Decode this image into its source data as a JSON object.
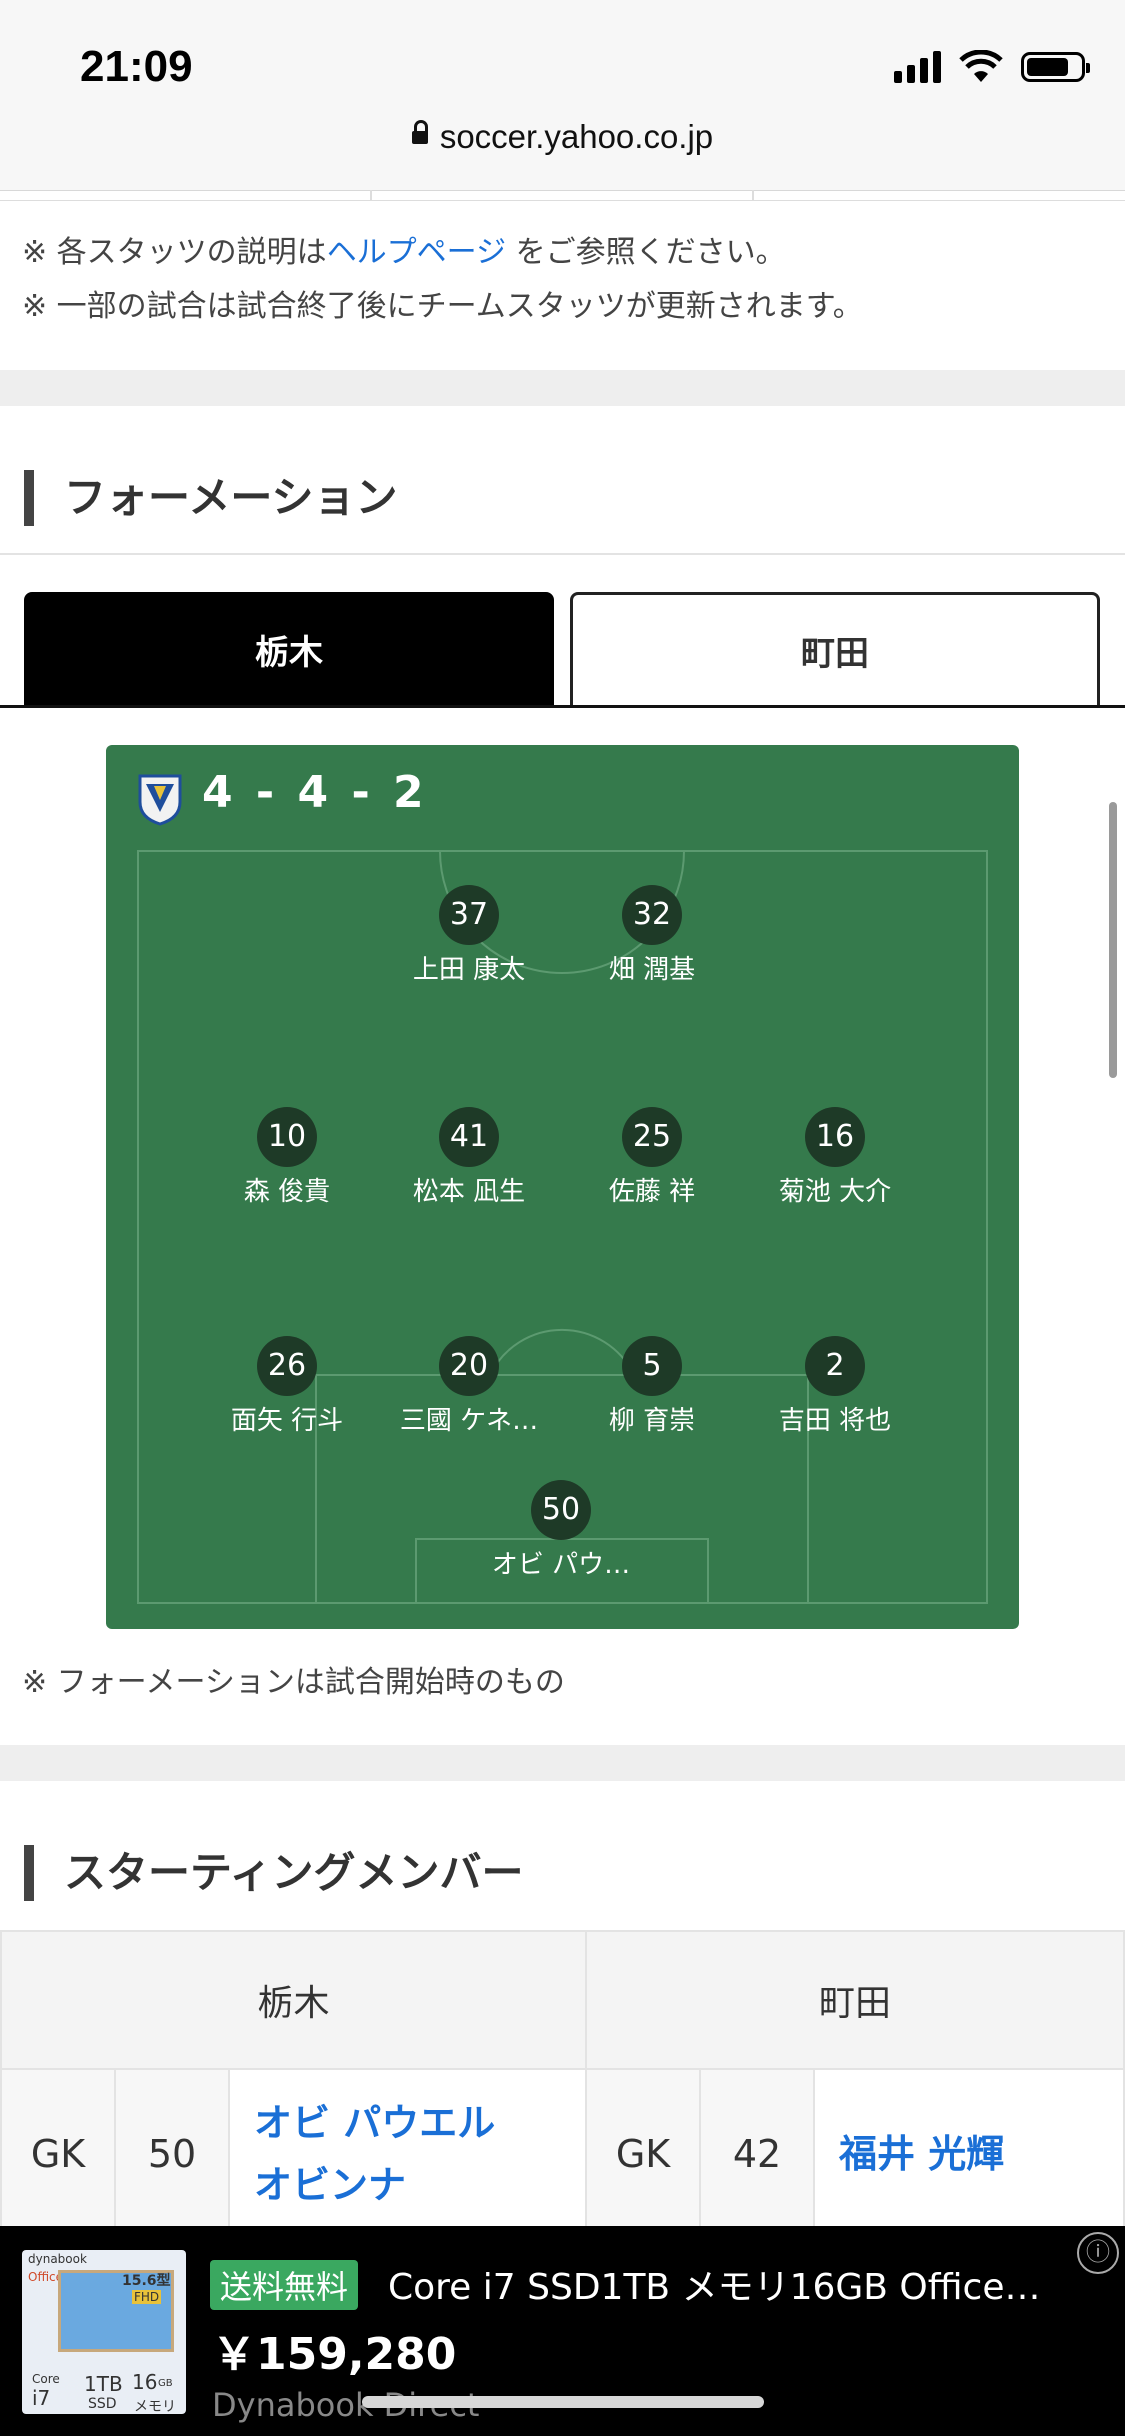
{
  "status_bar": {
    "time": "21:09",
    "url": "soccer.yahoo.co.jp"
  },
  "notes": {
    "line1_prefix": "※ 各スタッツの説明は",
    "line1_link": "ヘルプページ",
    "line1_suffix": "をご参照ください。",
    "line2": "※ 一部の試合は試合終了後にチームスタッツが更新されます。"
  },
  "formation_section": {
    "title": "フォーメーション",
    "tabs": [
      {
        "label": "栃木",
        "active": true
      },
      {
        "label": "町田",
        "active": false
      }
    ],
    "formation": "4 - 4 - 2",
    "players": [
      {
        "number": "37",
        "name": "上田 康太"
      },
      {
        "number": "32",
        "name": "畑 潤基"
      },
      {
        "number": "10",
        "name": "森 俊貴"
      },
      {
        "number": "41",
        "name": "松本 凪生"
      },
      {
        "number": "25",
        "name": "佐藤 祥"
      },
      {
        "number": "16",
        "name": "菊池 大介"
      },
      {
        "number": "26",
        "name": "面矢 行斗"
      },
      {
        "number": "20",
        "name": "三國 ケネ…"
      },
      {
        "number": "5",
        "name": "柳 育崇"
      },
      {
        "number": "2",
        "name": "吉田 将也"
      },
      {
        "number": "50",
        "name": "オビ パウ…"
      }
    ],
    "note": "※ フォーメーションは試合開始時のもの"
  },
  "starting_section": {
    "title": "スターティングメンバー",
    "teams": [
      "栃木",
      "町田"
    ],
    "rows": [
      {
        "home_pos": "GK",
        "home_no": "50",
        "home_name_line1": "オビ パウエル",
        "home_name_line2": "オビンナ",
        "away_pos": "GK",
        "away_no": "42",
        "away_name": "福井 光輝"
      }
    ]
  },
  "ad": {
    "badge": "送料無料",
    "title": "Core i7 SSD1TB メモリ16GB Office…",
    "price": "￥159,280",
    "source": "Dynabook Direct",
    "info_icon": "info-icon",
    "thumb": {
      "brand": "dynabook",
      "office": "Office",
      "size": "15.6型",
      "fhd": "FHD",
      "cpu_top": "Core",
      "cpu": "i7",
      "ssd": "1TB",
      "ssd_label": "SSD",
      "mem": "16",
      "mem_unit": "GB",
      "mem_label": "メモリ"
    }
  },
  "colors": {
    "pitch": "#357a4c",
    "link": "#1a6fd6",
    "ad_badge": "#3aa860"
  }
}
